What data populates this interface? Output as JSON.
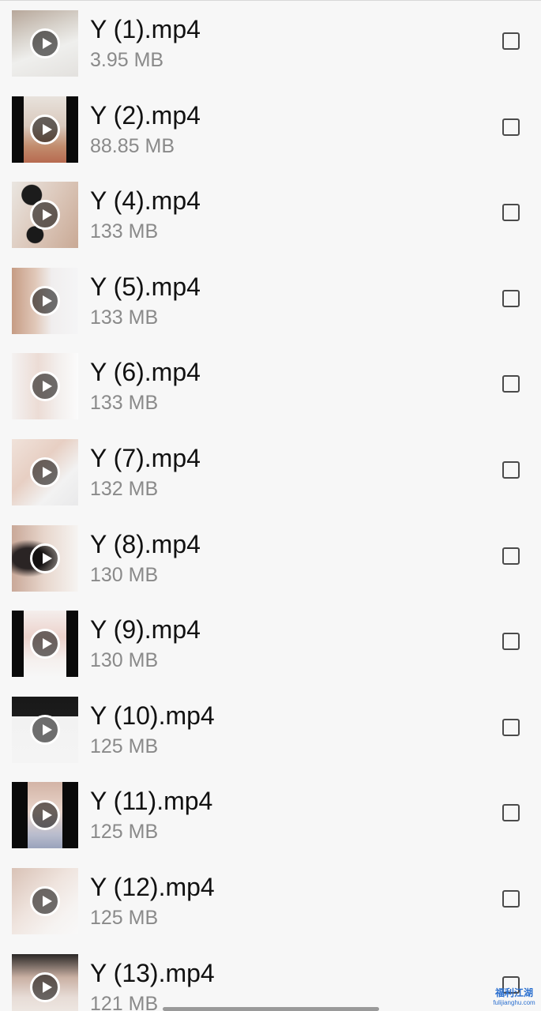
{
  "files": [
    {
      "name": "Y (1).mp4",
      "size": "3.95 MB"
    },
    {
      "name": "Y (2).mp4",
      "size": "88.85 MB"
    },
    {
      "name": "Y (4).mp4",
      "size": "133 MB"
    },
    {
      "name": "Y (5).mp4",
      "size": "133 MB"
    },
    {
      "name": "Y (6).mp4",
      "size": "133 MB"
    },
    {
      "name": "Y (7).mp4",
      "size": "132 MB"
    },
    {
      "name": "Y (8).mp4",
      "size": "130 MB"
    },
    {
      "name": "Y (9).mp4",
      "size": "130 MB"
    },
    {
      "name": "Y (10).mp4",
      "size": "125 MB"
    },
    {
      "name": "Y (11).mp4",
      "size": "125 MB"
    },
    {
      "name": "Y (12).mp4",
      "size": "125 MB"
    },
    {
      "name": "Y (13).mp4",
      "size": "121 MB"
    }
  ],
  "icons": {
    "thumbnail_overlay": "play-icon",
    "selection": "checkbox-icon"
  },
  "watermark": {
    "main": "福利江湖",
    "sub": "fulijianghu.com"
  },
  "colors": {
    "background": "#f7f7f7",
    "name_text": "#111111",
    "size_text": "#8a8a8a",
    "watermark": "#2a6fcf"
  }
}
